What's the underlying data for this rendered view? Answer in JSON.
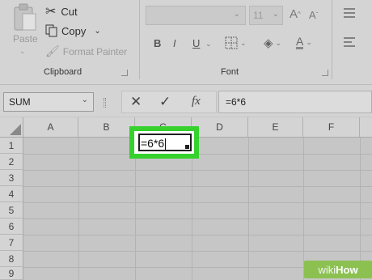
{
  "ribbon": {
    "clipboard": {
      "paste_label": "Paste",
      "cut_label": "Cut",
      "copy_label": "Copy",
      "format_painter_label": "Format Painter",
      "group_label": "Clipboard"
    },
    "font": {
      "font_name_value": "",
      "font_size_value": "11",
      "grow_font": "A",
      "shrink_font": "A",
      "bold": "B",
      "italic": "I",
      "underline": "U",
      "font_color": "A",
      "group_label": "Font"
    }
  },
  "formula_bar": {
    "name_box": "SUM",
    "fx_label": "fx",
    "formula": "=6*6"
  },
  "sheet": {
    "columns": [
      "A",
      "B",
      "C",
      "D",
      "E",
      "F"
    ],
    "rows": [
      "1",
      "2",
      "3",
      "4",
      "5",
      "6",
      "7",
      "8",
      "9"
    ],
    "active_cell_text": "=6*6"
  },
  "watermark": {
    "part1": "wiki",
    "part2": "How"
  },
  "colors": {
    "highlight": "#36d12c",
    "ribbon": "#d4d4d4",
    "grid": "#c6c6c6"
  }
}
